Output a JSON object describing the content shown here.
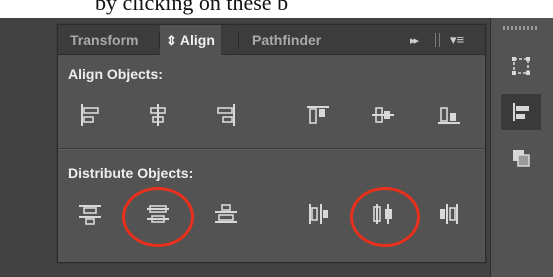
{
  "top_text": "by clicking on these b",
  "panel": {
    "tabs": [
      {
        "label": "Transform",
        "active": false
      },
      {
        "label": "Align",
        "active": true
      },
      {
        "label": "Pathfinder",
        "active": false
      }
    ],
    "active_tab_chevron": "⇕",
    "expand_glyph": "▸▸",
    "menu_glyph": "▾≡",
    "align_section_label": "Align Objects:",
    "distribute_section_label": "Distribute Objects:"
  },
  "align_buttons": [
    {
      "name": "align-left-edges-icon"
    },
    {
      "name": "align-horizontal-centers-icon"
    },
    {
      "name": "align-right-edges-icon"
    },
    {
      "name": "align-top-edges-icon"
    },
    {
      "name": "align-vertical-centers-icon"
    },
    {
      "name": "align-bottom-edges-icon"
    }
  ],
  "distribute_buttons": [
    {
      "name": "distribute-top-edges-icon",
      "highlighted": false
    },
    {
      "name": "distribute-vertical-centers-icon",
      "highlighted": true
    },
    {
      "name": "distribute-bottom-edges-icon",
      "highlighted": false
    },
    {
      "name": "distribute-left-edges-icon",
      "highlighted": false
    },
    {
      "name": "distribute-horizontal-centers-icon",
      "highlighted": true
    },
    {
      "name": "distribute-right-edges-icon",
      "highlighted": false
    }
  ],
  "dock": [
    {
      "name": "transform-panel-icon",
      "active": false
    },
    {
      "name": "align-panel-icon",
      "active": true
    },
    {
      "name": "pathfinder-panel-icon",
      "active": false
    }
  ],
  "colors": {
    "panel_bg": "#535353",
    "tab_bg": "#3c3c3c",
    "highlight_circle": "#e8301c",
    "icon": "#d8d8d8"
  }
}
